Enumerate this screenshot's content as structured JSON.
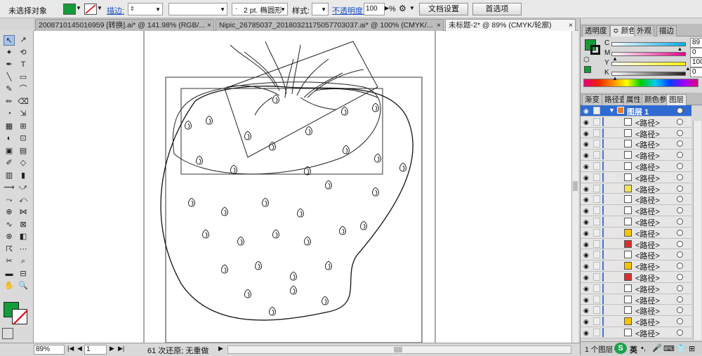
{
  "control_bar": {
    "selection_label": "未选择对象",
    "stroke_label": "描边:",
    "stroke_weight": "",
    "brush_value": "2 pt. 椭圆形",
    "style_label": "样式:",
    "opacity_label": "不透明度:",
    "opacity_value": "100",
    "opacity_unit": "%",
    "doc_setup": "文档设置",
    "preferences": "首选项",
    "fill_color": "#169b3a",
    "stroke_color": "#cc0000"
  },
  "tabs": [
    {
      "label": "2008710145016959 [转换].ai* @ 141.98% (RGB/...",
      "close": "×"
    },
    {
      "label": "Nipic_26785037_20180321175057703037.ai* @ 100% (CMYK/...",
      "close": "×"
    },
    {
      "label": "未标题-2* @ 89% (CMYK/轮廓)",
      "close": "×"
    }
  ],
  "tools": [
    "↖",
    "↗",
    "✦",
    "⟲",
    "✒",
    "T",
    "╲",
    "▭",
    "✎",
    "⌒",
    "✏",
    "⌫",
    "◔",
    "⇲",
    "▦",
    "⊞",
    "◐",
    "⊡",
    "▣",
    "▤",
    "✐",
    "◇",
    "▥",
    "▮",
    "⟿",
    "⤻",
    "⤳",
    "⤺",
    "⊕",
    "⋈",
    "∿",
    "⊠",
    "⊗",
    "◧",
    "☈",
    "⋯",
    "✂",
    "⌕",
    "▬",
    "⊟",
    "✋",
    "🔍"
  ],
  "status": {
    "zoom": "89%",
    "page": "1",
    "message": "61 次还原; 无重做"
  },
  "panel": {
    "top_tabs": [
      "透明度",
      "颜色",
      "外观",
      "描边"
    ],
    "active_top": "颜色",
    "cmyk": [
      {
        "label": "C",
        "value": "89",
        "color": "#00aeef"
      },
      {
        "label": "M",
        "value": "0",
        "color": "#ec008c"
      },
      {
        "label": "Y",
        "value": "100",
        "color": "#fff200"
      },
      {
        "label": "K",
        "value": "0",
        "color": "#231f20"
      }
    ],
    "pct": "%",
    "mid_tabs": [
      "渐变",
      "路径查",
      "属性",
      "颜色参",
      "图层"
    ],
    "layer_name": "图层 1",
    "path_label": "<路径>",
    "layer_count": "1 个图层",
    "ime_label": "英"
  },
  "path_rows": [
    {
      "thumb": "#ffffff"
    },
    {
      "thumb": "#ffffff"
    },
    {
      "thumb": "#ffffff"
    },
    {
      "thumb": "#ffffff"
    },
    {
      "thumb": "#ffffff"
    },
    {
      "thumb": "#ffffff"
    },
    {
      "thumb": "#f5e25a"
    },
    {
      "thumb": "#ffffff"
    },
    {
      "thumb": "#ffffff"
    },
    {
      "thumb": "#ffffff"
    },
    {
      "thumb": "#f5c400"
    },
    {
      "thumb": "#d83030"
    },
    {
      "thumb": "#ffffff"
    },
    {
      "thumb": "#f5c400"
    },
    {
      "thumb": "#d83030"
    },
    {
      "thumb": "#ffffff"
    },
    {
      "thumb": "#ffffff"
    },
    {
      "thumb": "#ffffff"
    },
    {
      "thumb": "#f5c400"
    },
    {
      "thumb": "#ffffff"
    }
  ]
}
